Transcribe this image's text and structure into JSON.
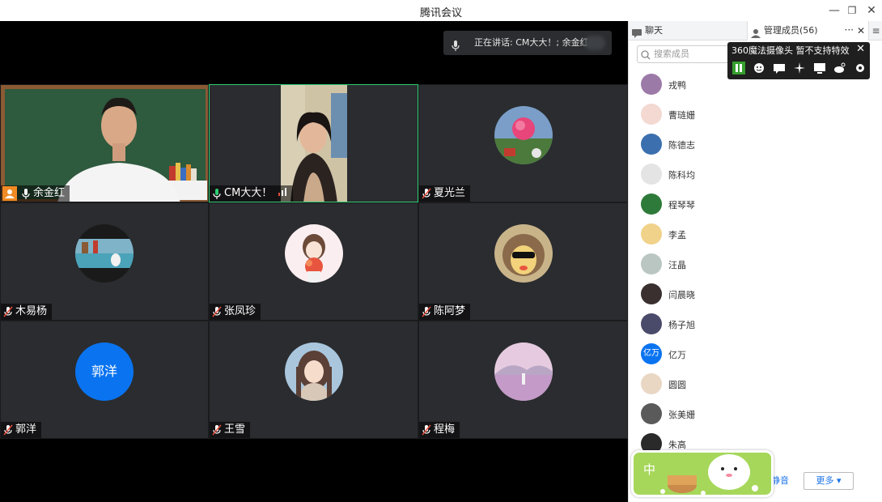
{
  "window": {
    "title": "腾讯会议",
    "minimize": "—",
    "restore": "❐",
    "close": "✕"
  },
  "speaking": {
    "text": "正在讲话: CM大大！; 余金红"
  },
  "tiles": [
    {
      "name": "余金红",
      "has_video": true
    },
    {
      "name": "CM大大！",
      "has_video": true
    },
    {
      "name": "夏光兰",
      "has_video": false
    },
    {
      "name": "木易杨",
      "has_video": false
    },
    {
      "name": "张凤珍",
      "has_video": false
    },
    {
      "name": "陈阿梦",
      "has_video": false
    },
    {
      "name": "郭洋",
      "has_video": false,
      "avatar_text": "郭洋"
    },
    {
      "name": "王雪",
      "has_video": false
    },
    {
      "name": "程梅",
      "has_video": false
    }
  ],
  "panel": {
    "tab_chat": "聊天",
    "tab_members": "管理成员(56)",
    "tab_dots": "···",
    "tab_close": "✕",
    "tab_menu": "≡",
    "search_placeholder": "搜索成员",
    "members": [
      {
        "name": "戎鸭"
      },
      {
        "name": "曹琏姗"
      },
      {
        "name": "陈德志"
      },
      {
        "name": "陈科均"
      },
      {
        "name": "程琴琴"
      },
      {
        "name": "李孟"
      },
      {
        "name": "汪晶"
      },
      {
        "name": "闫晨晓"
      },
      {
        "name": "杨子旭"
      },
      {
        "name": "亿万",
        "avatar_text": "亿万"
      },
      {
        "name": "圆圆"
      },
      {
        "name": "张美姗"
      },
      {
        "name": "朱高"
      }
    ],
    "btn_partial": "静音",
    "btn_more": "更多 ▾"
  },
  "cam_bar": {
    "title": "360魔法摄像头  暂不支持特效",
    "close": "✕"
  },
  "ime": {
    "label": "中"
  },
  "colors": {
    "active_border": "#2ecc71",
    "accent": "#0a73f0"
  }
}
